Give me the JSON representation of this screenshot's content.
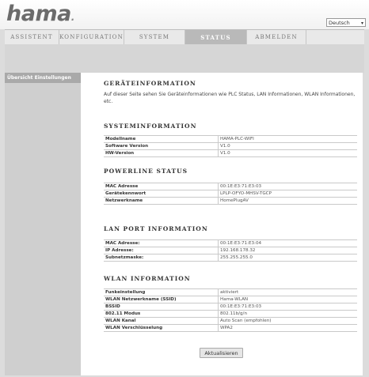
{
  "header": {
    "logo_text": "hama",
    "language": "Deutsch"
  },
  "nav": {
    "tabs": [
      {
        "label": "ASSISTENT"
      },
      {
        "label": "KONFIGURATION"
      },
      {
        "label": "SYSTEM"
      },
      {
        "label": "STATUS"
      },
      {
        "label": "ABMELDEN"
      }
    ],
    "active": "STATUS"
  },
  "sidebar": {
    "items": [
      {
        "label": "Übersicht Einstellungen"
      }
    ]
  },
  "device_info": {
    "title": "GERÄTEINFORMATION",
    "description": "Auf dieser Seite sehen Sie Geräteinformationen wie PLC Status, LAN Informationen, WLAN Informationen, etc."
  },
  "system_info": {
    "title": "SYSTEMINFORMATION",
    "rows": [
      {
        "key": "Modellname",
        "value": "HAMA-PLC-WIFI"
      },
      {
        "key": "Software Version",
        "value": "V1.0"
      },
      {
        "key": "HW-Version",
        "value": "V1.0"
      }
    ]
  },
  "powerline": {
    "title": "POWERLINE STATUS",
    "rows": [
      {
        "key": "MAC Adresse",
        "value": "00:1E:E3:71:E3:03"
      },
      {
        "key": "Gerätekennwort",
        "value": "LPLP-OFYO-MHSV-TGCP"
      },
      {
        "key": "Netzwerkname",
        "value": "HomePlugAV"
      }
    ]
  },
  "lan_port": {
    "title": "LAN PORT INFORMATION",
    "rows": [
      {
        "key": "MAC Adresse:",
        "value": "00:1E:E3:71:E3:04"
      },
      {
        "key": "IP Adresse:",
        "value": "192.168.178.32"
      },
      {
        "key": "Subnetzmaske:",
        "value": "255.255.255.0"
      }
    ]
  },
  "wlan": {
    "title": "WLAN INFORMATION",
    "rows": [
      {
        "key": "Funkeinstellung",
        "value": "aktiviert"
      },
      {
        "key": "WLAN Netzwerkname (SSID)",
        "value": "Hama-WLAN"
      },
      {
        "key": "BSSID",
        "value": "00:1E:E3:71:E3:03"
      },
      {
        "key": "802.11 Modus",
        "value": "802.11b/g/n"
      },
      {
        "key": "WLAN Kanal",
        "value": "Auto Scan (empfohlen)"
      },
      {
        "key": "WLAN Verschlüsselung",
        "value": "WPA2"
      }
    ]
  },
  "refresh_button": {
    "label": "Aktualisieren"
  }
}
